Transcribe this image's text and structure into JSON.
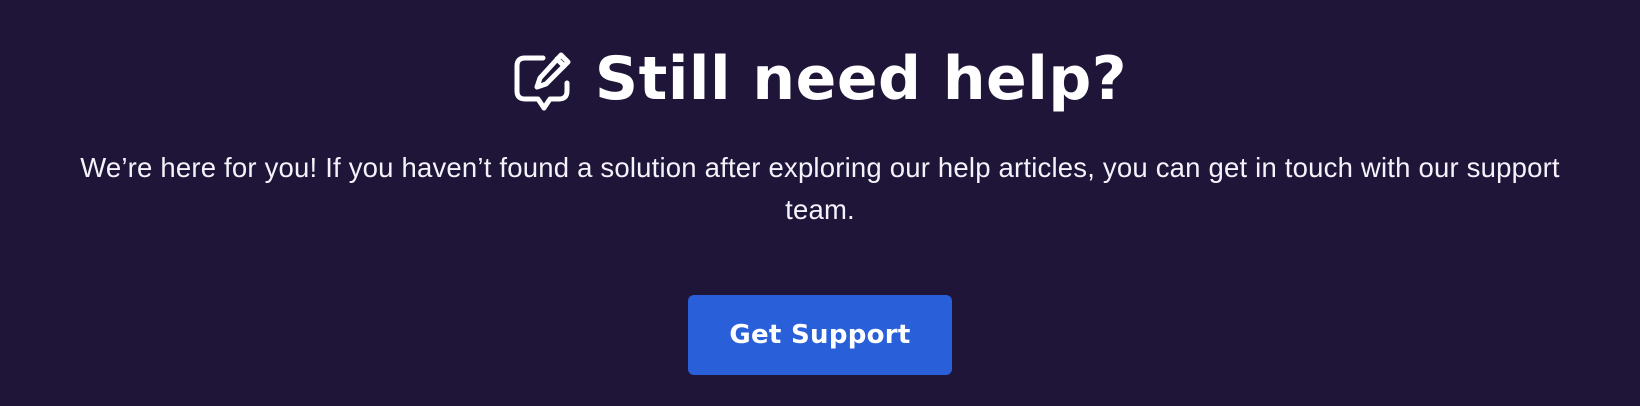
{
  "help_section": {
    "icon": "edit-chat-icon",
    "title": "Still need help?",
    "description": "We’re here for you! If you haven’t found a solution after exploring our help articles, you can get in touch with our support team.",
    "button_label": "Get Support"
  },
  "colors": {
    "background": "#1e1538",
    "text": "#ffffff",
    "button": "#2a5fda"
  }
}
